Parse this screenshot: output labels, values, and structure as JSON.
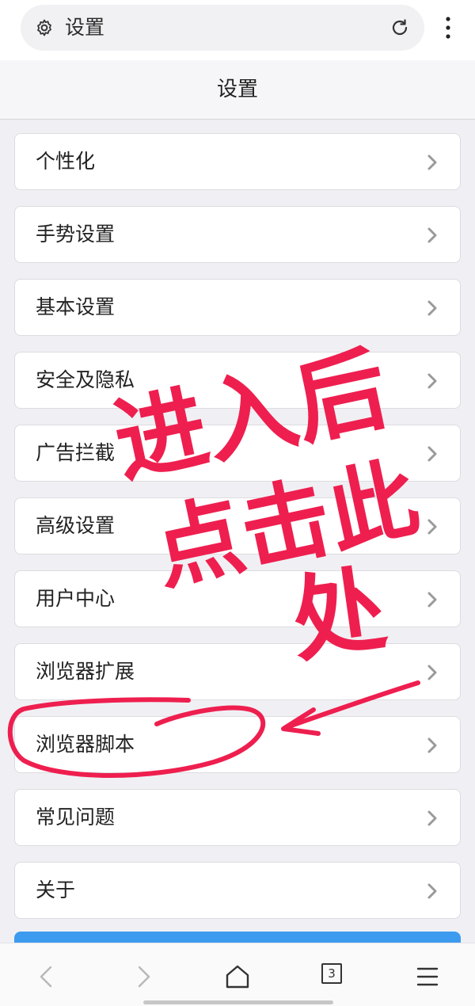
{
  "address_bar": {
    "text": "设置",
    "left_icon": "gear-icon",
    "reload_icon": "reload-icon",
    "menu_icon": "more-vertical-icon"
  },
  "header": {
    "title": "设置"
  },
  "settings_items": [
    {
      "label": "个性化"
    },
    {
      "label": "手势设置"
    },
    {
      "label": "基本设置"
    },
    {
      "label": "安全及隐私"
    },
    {
      "label": "广告拦截"
    },
    {
      "label": "高级设置"
    },
    {
      "label": "用户中心"
    },
    {
      "label": "浏览器扩展"
    },
    {
      "label": "浏览器脚本"
    },
    {
      "label": "常见问题"
    },
    {
      "label": "关于"
    }
  ],
  "bottom_nav": {
    "back_icon": "chevron-left-icon",
    "forward_icon": "chevron-right-icon",
    "home_icon": "home-icon",
    "tab_count": "3",
    "menu_icon": "hamburger-menu-icon"
  },
  "annotation": {
    "color": "#ee1f4f",
    "line1": "进入后",
    "line2": "点击此",
    "line3": "处",
    "circled_item": "浏览器脚本"
  },
  "colors": {
    "accent_blue": "#3d9bef",
    "background": "#f0f0f4",
    "annotation_red": "#ee1f4f"
  }
}
